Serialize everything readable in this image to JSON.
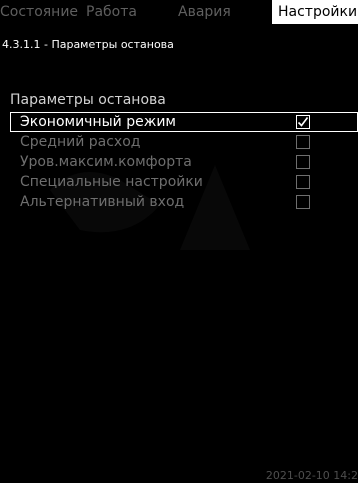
{
  "tabs": [
    {
      "label": "Состояние",
      "active": false
    },
    {
      "label": "Работа",
      "active": false
    },
    {
      "label": "Авария",
      "active": false
    },
    {
      "label": "Настройки",
      "active": true
    }
  ],
  "breadcrumb": "4.3.1.1 - Параметры останова",
  "section_title": "Параметры останова",
  "options": [
    {
      "label": "Экономичный режим",
      "checked": true
    },
    {
      "label": "Средний расход",
      "checked": false
    },
    {
      "label": "Уров.максим.комфорта",
      "checked": false
    },
    {
      "label": "Специальные настройки",
      "checked": false
    },
    {
      "label": "Альтернативный вход",
      "checked": false
    }
  ],
  "timestamp": "2021-02-10 14:2",
  "colors": {
    "background": "#000000",
    "active_tab_bg": "#ffffff",
    "inactive_text": "#6e6e6e",
    "selected_text": "#ffffff"
  }
}
